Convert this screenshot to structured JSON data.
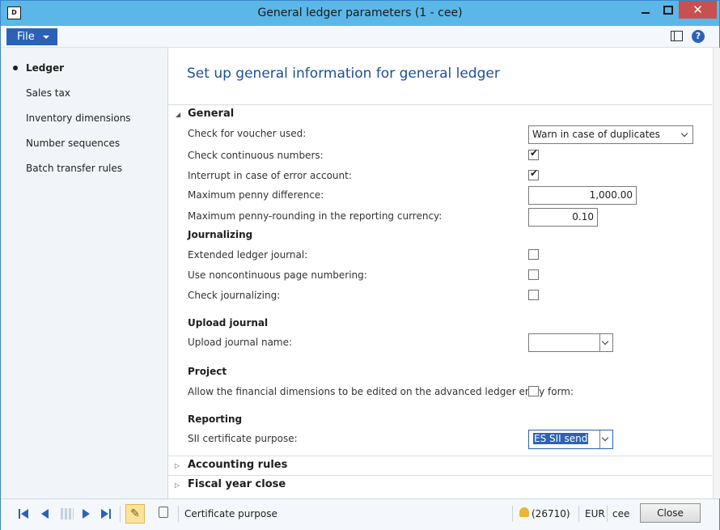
{
  "window": {
    "title": "General ledger parameters (1 - cee)",
    "app_icon_text": "D",
    "minimize_label": "",
    "maximize_label": "",
    "close_label": "✕"
  },
  "menu": {
    "file_label": "File",
    "help_label": "?"
  },
  "nav": {
    "items": [
      {
        "label": "Ledger",
        "selected": true
      },
      {
        "label": "Sales tax",
        "selected": false
      },
      {
        "label": "Inventory dimensions",
        "selected": false
      },
      {
        "label": "Number sequences",
        "selected": false
      },
      {
        "label": "Batch transfer rules",
        "selected": false
      }
    ]
  },
  "page": {
    "title": "Set up general information for general ledger"
  },
  "general": {
    "header": "General",
    "voucher_label": "Check for voucher used:",
    "voucher_value": "Warn in case of duplicates",
    "continuous_label": "Check continuous numbers:",
    "continuous_checked": true,
    "interrupt_label": "Interrupt in case of error account:",
    "interrupt_checked": true,
    "max_penny_label": "Maximum penny difference:",
    "max_penny_value": "1,000.00",
    "max_rounding_label": "Maximum penny-rounding in the reporting currency:",
    "max_rounding_value": "0.10",
    "journalizing_header": "Journalizing",
    "extended_label": "Extended ledger journal:",
    "extended_checked": false,
    "noncontinuous_label": "Use noncontinuous page numbering:",
    "noncontinuous_checked": false,
    "check_journalizing_label": "Check journalizing:",
    "check_journalizing_checked": false,
    "upload_header": "Upload journal",
    "upload_name_label": "Upload journal name:",
    "upload_name_value": "",
    "project_header": "Project",
    "project_label": "Allow the financial dimensions to be edited on the advanced ledger entry form:",
    "project_checked": false,
    "reporting_header": "Reporting",
    "sii_label": "SII certificate purpose:",
    "sii_value": "ES SII send"
  },
  "groups": {
    "accounting_rules": "Accounting rules",
    "fiscal_year_close": "Fiscal year close"
  },
  "status": {
    "help_text": "Certificate purpose",
    "notifications": "(26710)",
    "currency": "EUR",
    "company": "cee",
    "close_label": "Close",
    "edit_icon_glyph": "✎"
  },
  "colors": {
    "title_bar": "#5bb7e7",
    "accent": "#2b62b8",
    "close_btn": "#c75050",
    "page_title": "#1f4f96"
  }
}
